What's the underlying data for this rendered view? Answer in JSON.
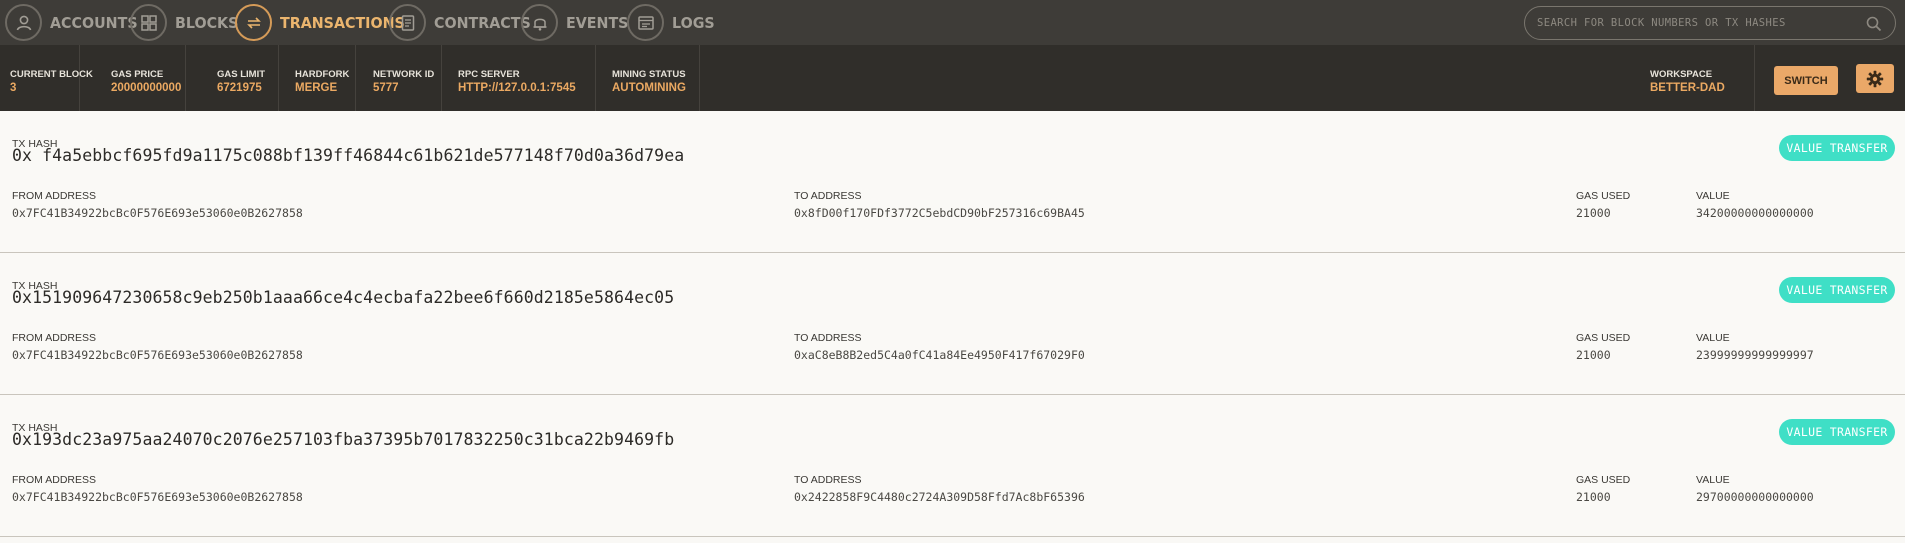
{
  "nav": {
    "items": [
      {
        "label": "ACCOUNTS",
        "icon": "account-icon"
      },
      {
        "label": "BLOCKS",
        "icon": "blocks-icon"
      },
      {
        "label": "TRANSACTIONS",
        "icon": "transactions-icon"
      },
      {
        "label": "CONTRACTS",
        "icon": "contracts-icon"
      },
      {
        "label": "EVENTS",
        "icon": "bell-icon"
      },
      {
        "label": "LOGS",
        "icon": "logs-icon"
      }
    ],
    "active": "TRANSACTIONS",
    "search_placeholder": "SEARCH FOR BLOCK NUMBERS OR TX HASHES"
  },
  "status": {
    "current_block": {
      "label": "CURRENT BLOCK",
      "value": "3"
    },
    "gas_price": {
      "label": "GAS PRICE",
      "value": "20000000000"
    },
    "gas_limit": {
      "label": "GAS LIMIT",
      "value": "6721975"
    },
    "hardfork": {
      "label": "HARDFORK",
      "value": "MERGE"
    },
    "network_id": {
      "label": "NETWORK ID",
      "value": "5777"
    },
    "rpc_server": {
      "label": "RPC SERVER",
      "value": "HTTP://127.0.0.1:7545"
    },
    "mining_status": {
      "label": "MINING STATUS",
      "value": "AUTOMINING"
    },
    "workspace": {
      "label": "WORKSPACE",
      "value": "BETTER-DAD"
    },
    "switch_label": "SWITCH"
  },
  "labels": {
    "tx_hash": "TX HASH",
    "from": "FROM ADDRESS",
    "to": "TO ADDRESS",
    "gas_used": "GAS USED",
    "value": "VALUE"
  },
  "transactions": [
    {
      "hash": "0x f4a5ebbcf695fd9a1175c088bf139ff46844c61b621de577148f70d0a36d79ea",
      "from": "0x7FC41B34922bcBc0F576E693e53060e0B2627858",
      "to": "0x8fD00f170FDf3772C5ebdCD90bF257316c69BA45",
      "gas_used": "21000",
      "value": "34200000000000000",
      "badge": "VALUE TRANSFER"
    },
    {
      "hash": "0x151909647230658c9eb250b1aaa66ce4c4ecbafa22bee6f660d2185e5864ec05",
      "from": "0x7FC41B34922bcBc0F576E693e53060e0B2627858",
      "to": "0xaC8eB8B2ed5C4a0fC41a84Ee4950F417f67029F0",
      "gas_used": "21000",
      "value": "23999999999999997",
      "badge": "VALUE TRANSFER"
    },
    {
      "hash": "0x193dc23a975aa24070c2076e257103fba37395b7017832250c31bca22b9469fb",
      "from": "0x7FC41B34922bcBc0F576E693e53060e0B2627858",
      "to": "0x2422858F9C4480c2724A309D58Ffd7Ac8bF65396",
      "gas_used": "21000",
      "value": "29700000000000000",
      "badge": "VALUE TRANSFER"
    }
  ],
  "colors": {
    "nav_bg": "#3e3c38",
    "status_bg": "#302e2a",
    "accent": "#eba962",
    "badge": "#3fdfc6"
  }
}
